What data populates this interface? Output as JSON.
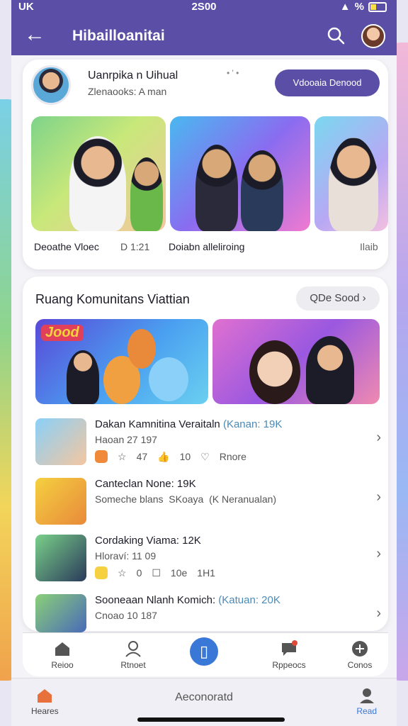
{
  "statusbar": {
    "left": "UK",
    "time": "2S00",
    "right": "%"
  },
  "header": {
    "title": "Hibailloanitai"
  },
  "profile": {
    "name": "Uanrpika n Uihual",
    "sub": "Zlenaooks: A man",
    "mid": "• ' •",
    "button": "Vdooaia Denood"
  },
  "featured": [
    {
      "caption": "Deoathe Vloec",
      "meta": "D 1:21"
    },
    {
      "caption": "Doiabn alleliroing",
      "meta": ""
    },
    {
      "caption": "Ilaib",
      "meta": ""
    }
  ],
  "community": {
    "title": "Ruang Komunitans Viattian",
    "see_all": "QDe Sood",
    "banner_label": "Jood"
  },
  "list": [
    {
      "title": "Dakan Kamnitina Veraitaln",
      "title_accent": "(Kanan: 19K",
      "sub": "Haoan 27 197",
      "m1": "47",
      "m2": "10",
      "m3": "Rnore",
      "color": "#f08a3a"
    },
    {
      "title": "Canteclan None: 19K",
      "title_accent": "",
      "sub": "Someche blans",
      "m1": "SKoaya",
      "m2": "(K Neranualan)",
      "m3": "",
      "color": "#4aa0f0"
    },
    {
      "title": "Cordaking Viama: 12K",
      "title_accent": "",
      "sub": "Hloraví: 11 09",
      "m1": "0",
      "m2": "10e",
      "m3": "1H1",
      "color": "#f5d040"
    },
    {
      "title": "Sooneaan Nlanh Komich:",
      "title_accent": "(Katuan: 20K",
      "sub": "Cnoao 10 187",
      "m1": "",
      "m2": "",
      "m3": "",
      "color": "#f5d040"
    }
  ],
  "tabs": [
    "Reioo",
    "Rtnoet",
    "",
    "Rppeocs",
    "Conos"
  ],
  "bottom": {
    "left": "Heares",
    "center": "Aeconoratd",
    "right": "Read"
  }
}
